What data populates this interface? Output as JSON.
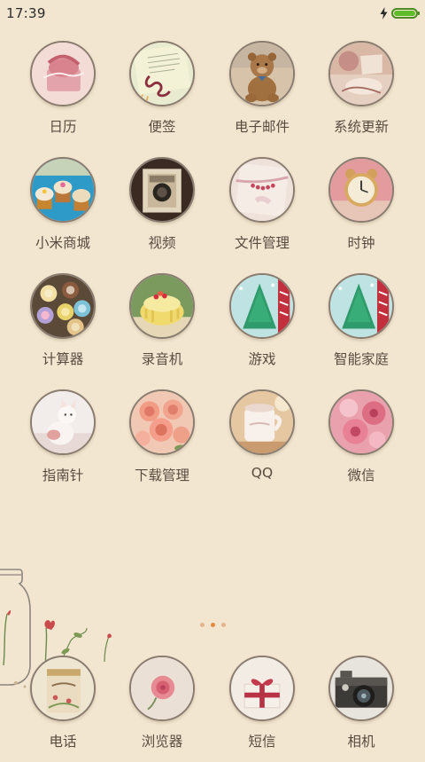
{
  "status": {
    "time": "17:39",
    "battery_level": 1.0,
    "charging": true
  },
  "apps": [
    {
      "label": "日历",
      "icon": "gift-photo-icon"
    },
    {
      "label": "便签",
      "icon": "notepad-photo-icon"
    },
    {
      "label": "电子邮件",
      "icon": "teddy-bear-photo-icon"
    },
    {
      "label": "系统更新",
      "icon": "vintage-still-life-photo-icon"
    },
    {
      "label": "小米商城",
      "icon": "cupcakes-photo-icon"
    },
    {
      "label": "视频",
      "icon": "vintage-camera-photo-icon"
    },
    {
      "label": "文件管理",
      "icon": "ribbon-letter-photo-icon"
    },
    {
      "label": "时钟",
      "icon": "alarm-clock-photo-icon"
    },
    {
      "label": "计算器",
      "icon": "macarons-photo-icon"
    },
    {
      "label": "录音机",
      "icon": "bundt-cake-photo-icon"
    },
    {
      "label": "游戏",
      "icon": "christmas-tree-card-photo-icon"
    },
    {
      "label": "智能家庭",
      "icon": "christmas-tree-card-photo-icon"
    },
    {
      "label": "指南针",
      "icon": "cat-photo-icon"
    },
    {
      "label": "下载管理",
      "icon": "roses-photo-icon"
    },
    {
      "label": "QQ",
      "icon": "coffee-cup-photo-icon"
    },
    {
      "label": "微信",
      "icon": "pink-flowers-photo-icon"
    }
  ],
  "page_indicator": {
    "count": 3,
    "active_index": 1
  },
  "dock": [
    {
      "label": "电话",
      "icon": "tin-box-photo-icon"
    },
    {
      "label": "浏览器",
      "icon": "pink-rose-photo-icon"
    },
    {
      "label": "短信",
      "icon": "gift-box-photo-icon"
    },
    {
      "label": "相机",
      "icon": "retro-camera-photo-icon"
    }
  ]
}
